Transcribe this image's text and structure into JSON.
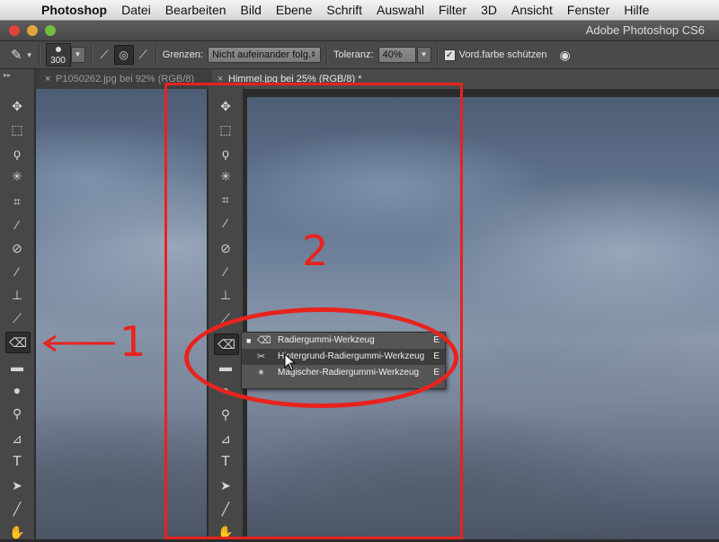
{
  "menubar": {
    "items": [
      "Photoshop",
      "Datei",
      "Bearbeiten",
      "Bild",
      "Ebene",
      "Schrift",
      "Auswahl",
      "Filter",
      "3D",
      "Ansicht",
      "Fenster",
      "Hilfe"
    ]
  },
  "window": {
    "title": "Adobe Photoshop CS6"
  },
  "options": {
    "brush_size": "300",
    "limits_label": "Grenzen:",
    "limits_value": "Nicht aufeinander folg.",
    "tolerance_label": "Toleranz:",
    "tolerance_value": "40%",
    "protect_label": "Vord.farbe schützen"
  },
  "tabs": [
    {
      "label": "P1050262.jpg bei 92% (RGB/8)"
    },
    {
      "label": "Himmel.jpg bei 25% (RGB/8) *"
    }
  ],
  "flyout": {
    "items": [
      {
        "label": "Radiergummi-Werkzeug",
        "shortcut": "E",
        "selected": true,
        "icon": "eraser-icon"
      },
      {
        "label": "Hintergrund-Radiergummi-Werkzeug",
        "shortcut": "E",
        "selected": false,
        "icon": "background-eraser-icon"
      },
      {
        "label": "Magischer-Radiergummi-Werkzeug",
        "shortcut": "E",
        "selected": false,
        "icon": "magic-eraser-icon"
      }
    ]
  },
  "annotations": {
    "label_1": "1",
    "label_2": "2",
    "color": "#e8231d"
  }
}
